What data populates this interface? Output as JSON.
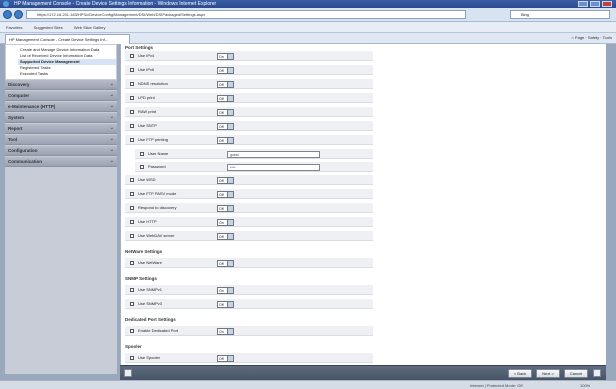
{
  "window": {
    "title": "HP Management Console - Create Device Settings Information - Windows Internet Explorer"
  },
  "browser": {
    "url": "https://172.16.201.183/HPSc/DeviceConfig/Management/DSI/Web/DSIPackaged/Settings.aspx",
    "search_placeholder": "Bing",
    "favorites": [
      "Favorites",
      "Suggested Sites",
      "Web Slice Gallery"
    ],
    "tab_title": "HP Management Console - Create Device Settings Inf...",
    "tools": [
      "Page",
      "Safety",
      "Tools"
    ]
  },
  "sidebar": {
    "links": [
      {
        "label": "Create and Manage Device Information Data",
        "selected": false
      },
      {
        "label": "List of Received Device Information Data",
        "selected": false
      },
      {
        "label": "Supported Device Management",
        "selected": true
      },
      {
        "label": "Registered Tasks",
        "selected": false
      },
      {
        "label": "Executed Tasks",
        "selected": false
      }
    ],
    "sections": [
      "Discovery",
      "Computer",
      "e-Maintenance (HTTP)",
      "System",
      "Report",
      "Tool",
      "Configuration",
      "Communication"
    ]
  },
  "main": {
    "header_partial": "Port Settings",
    "groups": [
      {
        "title": "",
        "rows": [
          {
            "label": "Use IPv4",
            "value": "On"
          },
          {
            "label": "Use IPv6",
            "value": "Off"
          },
          {
            "label": "NDNS resolution",
            "value": "Off"
          },
          {
            "label": "LPD print",
            "value": "Off"
          },
          {
            "label": "RAW print",
            "value": "Off"
          },
          {
            "label": "Use SNTP",
            "value": "Off"
          },
          {
            "label": "Use FTP printing",
            "value": "Off"
          },
          {
            "label": "User Name",
            "value": "guest",
            "type": "text",
            "sub": true
          },
          {
            "label": "Password",
            "value": "****",
            "type": "text",
            "sub": true
          },
          {
            "label": "Use WSD",
            "value": "Off"
          },
          {
            "label": "Use FTP PASV mode",
            "value": "Off"
          },
          {
            "label": "Respond to discovery",
            "value": "Off"
          },
          {
            "label": "Use HTTP",
            "value": "On"
          },
          {
            "label": "Use WebDAV server",
            "value": "Off"
          }
        ]
      },
      {
        "title": "NetWare Settings",
        "rows": [
          {
            "label": "Use NetWare",
            "value": "Off"
          }
        ]
      },
      {
        "title": "SNMP Settings",
        "rows": [
          {
            "label": "Use SNMPv1",
            "value": "On"
          },
          {
            "label": "Use SNMPv3",
            "value": "Off"
          }
        ]
      },
      {
        "title": "Dedicated Port Settings",
        "rows": [
          {
            "label": "Enable Dedicated Port",
            "value": "On"
          }
        ]
      },
      {
        "title": "Spooler",
        "rows": [
          {
            "label": "Use Spooler",
            "value": "Off"
          }
        ]
      }
    ]
  },
  "footer": {
    "back": "< Back",
    "next": "Next >",
    "cancel": "Cancel",
    "help": "Help"
  },
  "status": {
    "zone": "Internet | Protected Mode: Off",
    "zoom": "100%"
  }
}
